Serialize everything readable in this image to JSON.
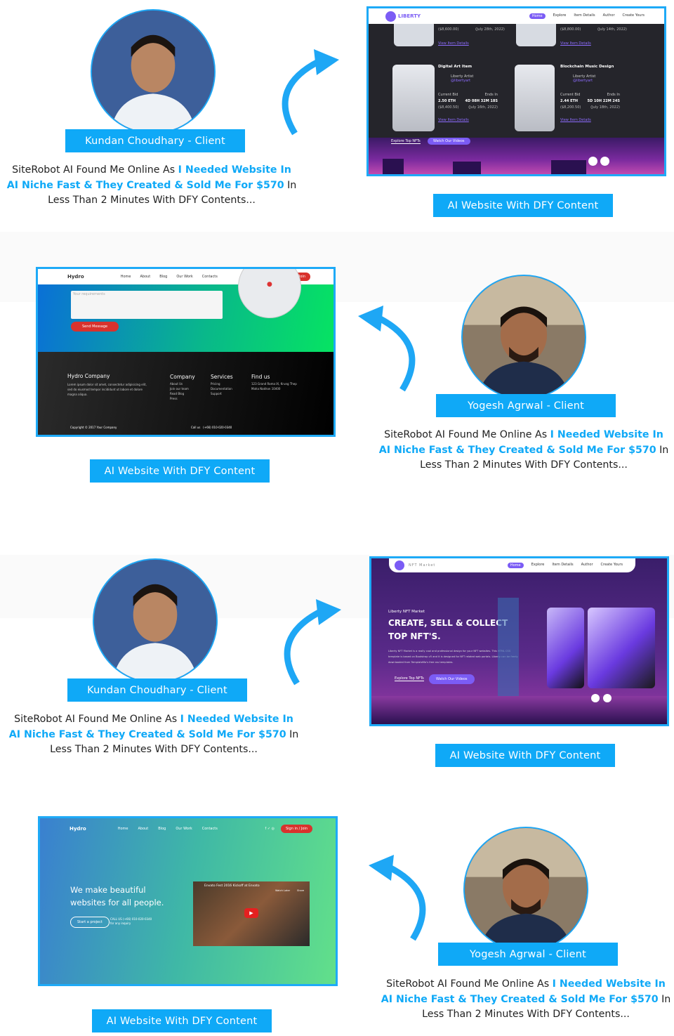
{
  "testimonial": {
    "line1_plain": "SiteRobot AI Found Me Online As ",
    "line1_highlight": "I Needed Website In",
    "line2_highlight": "AI Niche Fast & They Created & Sold Me For $570",
    "line2_plain": " In",
    "line3_plain": "Less Than 2 Minutes With DFY Contents..."
  },
  "colors": {
    "accent": "#0fa9f7",
    "text": "#222222"
  },
  "website_label": "AI Website With DFY Content",
  "clients": [
    "Kundan Choudhary - Client",
    "Yogesh Agrwal - Client",
    "Kundan Choudhary - Client",
    "Yogesh Agrwal - Client"
  ],
  "liberty": {
    "logo": "LIBERTY",
    "logo_sub": "NFT Market",
    "nav": [
      "Home",
      "Explore",
      "Item Details",
      "Author",
      "Create Yours"
    ],
    "top_cards": [
      {
        "usd": "($8,600.00)",
        "date": "(July 28th, 2022)"
      },
      {
        "usd": "($8,800.00)",
        "date": "(July 14th, 2022)"
      }
    ],
    "view_details": "View Item Details",
    "cards": [
      {
        "title": "Digital Art Item",
        "artist": "Liberty Artist",
        "handle": "@libertyart",
        "bid_label": "Current Bid",
        "ends_label": "Ends In",
        "bid": "2.50 ETH",
        "ends": "4D 08H 32M 18S",
        "usd": "($8,400.50)",
        "date": "(July 16th, 2022)"
      },
      {
        "title": "Blockchain Music Design",
        "artist": "Liberty Artist",
        "handle": "@libertyart",
        "bid_label": "Current Bid",
        "ends_label": "Ends In",
        "bid": "2.44 ETH",
        "ends": "5D 10H 22M 24S",
        "usd": "($8,200.50)",
        "date": "(July 18th, 2022)"
      }
    ],
    "btn_explore": "Explore Top NFTs",
    "btn_videos": "Watch Our Videos",
    "hero_kicker": "Liberty NFT Market",
    "hero_title_1": "CREATE, SELL & COLLECT",
    "hero_title_2": "TOP NFT'S.",
    "hero_desc": "Liberty NFT Market is a really cool and professional design for your NFT websites. This HTML CSS template is based on Bootstrap v5 and it is designed for NFT related web portals. Liberty can be freely downloaded from TemplateMo's free css templates."
  },
  "hydro": {
    "logo": "Hydro",
    "nav": [
      "Home",
      "About",
      "Blog",
      "Our Work",
      "Contacts"
    ],
    "signin": "Sign in / Join",
    "textarea_placeholder": "Your requirements",
    "send": "Send Message",
    "company": "Hydro Company",
    "company_desc": "Lorem ipsum dolor sit amet, consectetur adipisicing elit, sed do eiusmod tempor incididunt ut labore et dolore magna aliqua.",
    "col_company": "Company",
    "col_company_items": [
      "About Us",
      "Join our team",
      "Read Blog",
      "Press"
    ],
    "col_services": "Services",
    "col_services_items": [
      "Pricing",
      "Documentation",
      "Support"
    ],
    "col_find": "Find us",
    "address": "123 Grand Rama IX, Krung Thep Maha Nakhon 10400",
    "copyright": "Copyright © 2017 Your Company",
    "call": "Call us   (+66) 010-020-0340",
    "hero_1": "We make beautiful",
    "hero_2": "websites for all people.",
    "start": "Start a project",
    "call_hero": "CALL US (+66) 010-020-0340",
    "call_hero_sub": "for any inquiry",
    "video_title": "Envato Fest 2016 Kickoff at Envato",
    "watch_later": "Watch Later",
    "share": "Share"
  }
}
